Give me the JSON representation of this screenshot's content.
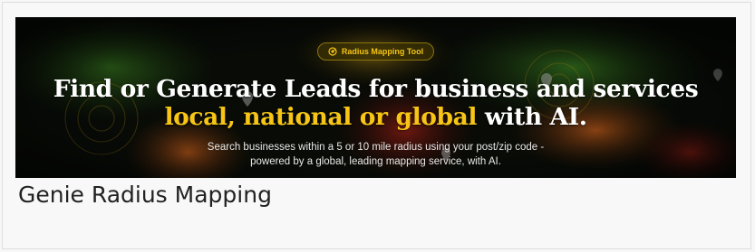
{
  "banner": {
    "badge_label": "Radius Mapping Tool",
    "badge_icon": "radius-icon",
    "headline_line1": "Find or Generate Leads for business and services",
    "headline_line2_highlight": "local, national or global",
    "headline_line2_rest": " with AI.",
    "subtext_line1": "Search businesses within a 5 or 10 mile radius using your post/zip code -",
    "subtext_line2": "powered by a global, leading mapping service, with AI.",
    "colors": {
      "accent": "#f6c516",
      "background": "#0b0f09",
      "map_green": "#2f6a1e",
      "map_orange": "#b8521a",
      "map_red": "#8c1e16"
    }
  },
  "page": {
    "title": "Genie Radius Mapping"
  }
}
